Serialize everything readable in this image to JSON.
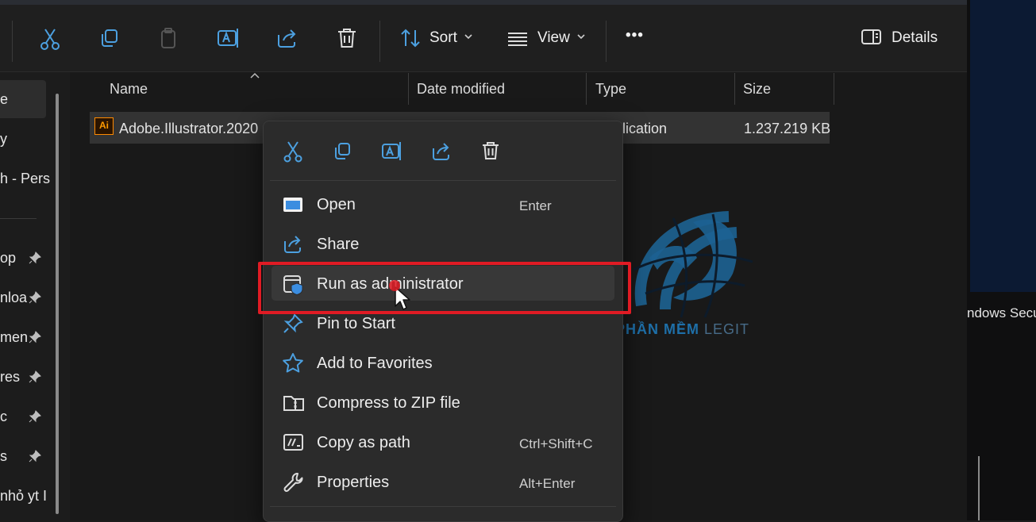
{
  "toolbar": {
    "cut_icon": "scissors-icon",
    "copy_icon": "copy-icon",
    "paste_icon": "paste-icon",
    "rename_icon": "rename-icon",
    "share_icon": "share-icon",
    "delete_icon": "trash-icon",
    "sort_label": "Sort",
    "view_label": "View",
    "more_label": "•••",
    "details_label": "Details"
  },
  "sidebar": {
    "items": [
      {
        "label": "e",
        "pinned": false
      },
      {
        "label": "y",
        "pinned": false
      },
      {
        "label": "h - Pers",
        "pinned": false
      },
      {
        "label": "op",
        "pinned": true
      },
      {
        "label": "nloac",
        "pinned": true
      },
      {
        "label": "men",
        "pinned": true
      },
      {
        "label": "res",
        "pinned": true
      },
      {
        "label": "c",
        "pinned": true
      },
      {
        "label": "s",
        "pinned": true
      },
      {
        "label": "nhỏ yt I",
        "pinned": false
      }
    ]
  },
  "columns": {
    "name": "Name",
    "date_modified": "Date modified",
    "type": "Type",
    "size": "Size"
  },
  "file": {
    "icon_text": "Ai",
    "name": "Adobe.Illustrator.2020",
    "type": "lication",
    "size": "1.237.219 KB"
  },
  "context_menu": {
    "items": [
      {
        "label": "Open",
        "accelerator": "Enter",
        "icon": "open-icon"
      },
      {
        "label": "Share",
        "accelerator": "",
        "icon": "share-icon"
      },
      {
        "label": "Run as administrator",
        "accelerator": "",
        "icon": "shield-icon"
      },
      {
        "label": "Pin to Start",
        "accelerator": "",
        "icon": "pin-icon"
      },
      {
        "label": "Add to Favorites",
        "accelerator": "",
        "icon": "star-icon"
      },
      {
        "label": "Compress to ZIP file",
        "accelerator": "",
        "icon": "zip-icon"
      },
      {
        "label": "Copy as path",
        "accelerator": "Ctrl+Shift+C",
        "icon": "path-icon"
      },
      {
        "label": "Properties",
        "accelerator": "Alt+Enter",
        "icon": "wrench-icon"
      }
    ]
  },
  "right_panel": {
    "text": "ndows Secu"
  },
  "watermark": {
    "brand": "PHẦN MỀM",
    "suffix": "LEGIT"
  },
  "colors": {
    "highlight_box": "#e01b24",
    "accent_blue": "#4ca0e0",
    "watermark_blue": "#1e6fa8"
  }
}
